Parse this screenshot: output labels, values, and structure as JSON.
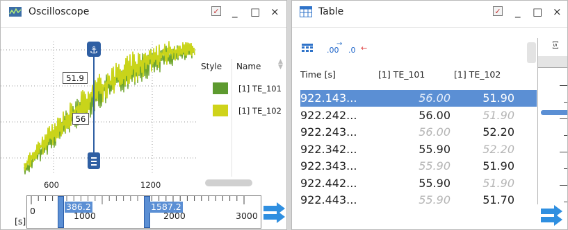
{
  "oscilloscope": {
    "title": "Oscilloscope",
    "minimize": "_",
    "maximize": "□",
    "close": "×",
    "cursor_value_1": "51.9",
    "cursor_value_2": "56",
    "legend_header_style": "Style",
    "legend_header_name": "Name",
    "legend_items": [
      {
        "name": "[1] TE_101",
        "color": "#5d9a2f"
      },
      {
        "name": "[1] TE_102",
        "color": "#cfd31a"
      }
    ],
    "x_ticks": [
      "600",
      "1200"
    ],
    "overview": {
      "unit": "[s]",
      "start_label": "0",
      "tick_1000": "1000",
      "tick_2000": "2000",
      "end_label": "3000",
      "marker_left": "386.2",
      "marker_right": "1587.2"
    }
  },
  "table": {
    "title": "Table",
    "minimize": "_",
    "maximize": "□",
    "close": "×",
    "toolbar": {
      "increase_decimals": ".00",
      "decrease_decimals": ".0"
    },
    "columns": [
      "Time [s]",
      "[1] TE_101",
      "[1] TE_102"
    ],
    "rows": [
      {
        "time": "922.143...",
        "te101": "56.00",
        "te101_muted": true,
        "te102": "51.90",
        "te102_muted": false,
        "selected": true
      },
      {
        "time": "922.242...",
        "te101": "56.00",
        "te101_muted": false,
        "te102": "51.90",
        "te102_muted": true,
        "selected": false
      },
      {
        "time": "922.243...",
        "te101": "56.00",
        "te101_muted": true,
        "te102": "52.20",
        "te102_muted": false,
        "selected": false
      },
      {
        "time": "922.342...",
        "te101": "55.90",
        "te101_muted": false,
        "te102": "52.20",
        "te102_muted": true,
        "selected": false
      },
      {
        "time": "922.343...",
        "te101": "55.90",
        "te101_muted": true,
        "te102": "51.90",
        "te102_muted": false,
        "selected": false
      },
      {
        "time": "922.442...",
        "te101": "55.90",
        "te101_muted": false,
        "te102": "51.90",
        "te102_muted": true,
        "selected": false
      },
      {
        "time": "922.443...",
        "te101": "55.90",
        "te101_muted": true,
        "te102": "51.70",
        "te102_muted": false,
        "selected": false
      }
    ],
    "gauge_unit": "[s]"
  },
  "colors": {
    "selection": "#5b8fd4",
    "muted_text": "#b5b5b5",
    "accent_blue": "#2f73c9"
  }
}
